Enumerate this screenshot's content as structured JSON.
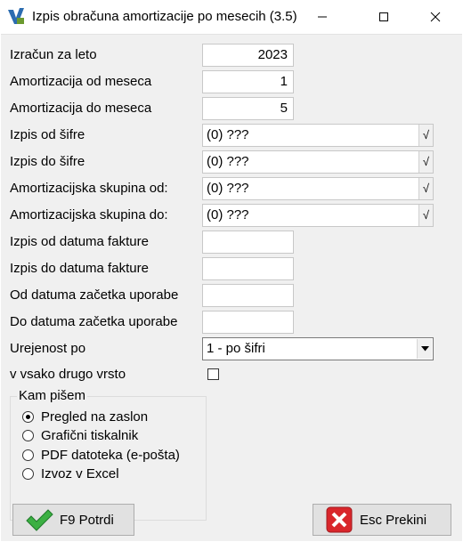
{
  "window": {
    "title": "Izpis obračuna amortizacije po mesecih  (3.5)"
  },
  "form": {
    "leto": {
      "label": "Izračun za leto",
      "value": "2023"
    },
    "od_meseca": {
      "label": "Amortizacija od meseca",
      "value": "1"
    },
    "do_meseca": {
      "label": "Amortizacija do meseca",
      "value": "5"
    },
    "od_sifre": {
      "label": "Izpis od šifre",
      "value": "(0) ???",
      "button": "√"
    },
    "do_sifre": {
      "label": "Izpis do šifre",
      "value": "(0) ???",
      "button": "√"
    },
    "skupina_od": {
      "label": "Amortizacijska skupina od:",
      "value": "(0) ???",
      "button": "√"
    },
    "skupina_do": {
      "label": "Amortizacijska skupina do:",
      "value": "(0) ???",
      "button": "√"
    },
    "datum_fakture_od": {
      "label": "Izpis od datuma fakture",
      "value": ""
    },
    "datum_fakture_do": {
      "label": "Izpis do datuma fakture",
      "value": ""
    },
    "uporaba_od": {
      "label": "Od datuma začetka uporabe",
      "value": ""
    },
    "uporaba_do": {
      "label": "Do datuma začetka uporabe",
      "value": ""
    },
    "urejenost": {
      "label": "Urejenost po",
      "selected": "1 - po šifri"
    },
    "vsako_drugo": {
      "label": "v vsako drugo vrsto",
      "checked": false
    }
  },
  "output": {
    "legend": "Kam pišem",
    "options": [
      {
        "label": "Pregled na zaslon",
        "checked": true
      },
      {
        "label": "Grafični tiskalnik",
        "checked": false
      },
      {
        "label": "PDF datoteka (e-pošta)",
        "checked": false
      },
      {
        "label": "Izvoz v Excel",
        "checked": false
      }
    ]
  },
  "buttons": {
    "confirm": {
      "label": "F9 Potrdi",
      "icon": "checkmark-icon",
      "color": "#3cb043"
    },
    "cancel": {
      "label": "Esc Prekini",
      "icon": "x-icon",
      "color": "#d9262b"
    }
  }
}
